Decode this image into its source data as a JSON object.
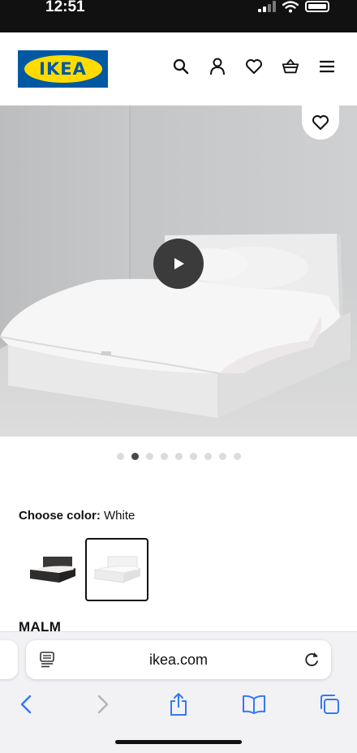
{
  "status_bar": {
    "time": "12:51"
  },
  "header": {
    "logo_text": "IKEA",
    "brand_blue": "#0058a3",
    "brand_yellow": "#ffdb00",
    "icons": [
      "search-icon",
      "account-icon",
      "heart-icon",
      "basket-icon",
      "menu-icon"
    ]
  },
  "hero": {
    "carousel_total": 9,
    "carousel_active": 2
  },
  "color_chooser": {
    "label": "Choose color:",
    "value": "White",
    "options": [
      {
        "name": "Black-brown",
        "selected": false
      },
      {
        "name": "White",
        "selected": true
      }
    ]
  },
  "product": {
    "name": "MALM"
  },
  "browser": {
    "url": "ikea.com",
    "accent": "#3478f6"
  }
}
